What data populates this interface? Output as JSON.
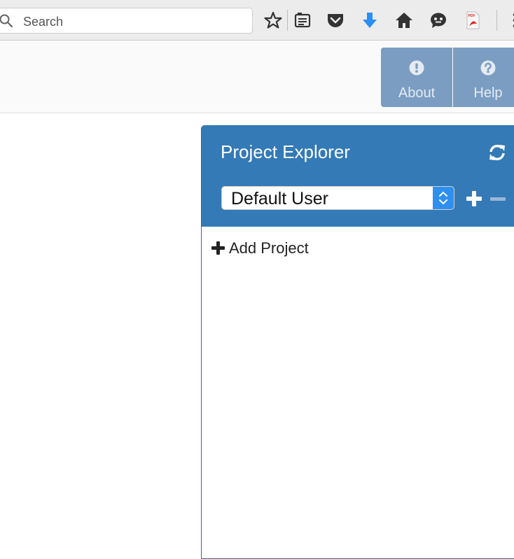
{
  "browser": {
    "search": {
      "placeholder": "Search",
      "value": ""
    },
    "toolbar_icons": [
      "star-icon",
      "reading-list-icon",
      "pocket-icon",
      "download-icon",
      "home-icon",
      "chat-icon",
      "pdf-icon",
      "menu-icon"
    ],
    "download_icon_color": "#2a8ff7",
    "pdf_icon_label": "PDF"
  },
  "header": {
    "about_label": "About",
    "help_label": "Help",
    "button_color": "#7b9dc2"
  },
  "explorer": {
    "title": "Project Explorer",
    "selected_user": "Default User",
    "add_project_label": "Add Project",
    "accent_color": "#337ab7"
  }
}
